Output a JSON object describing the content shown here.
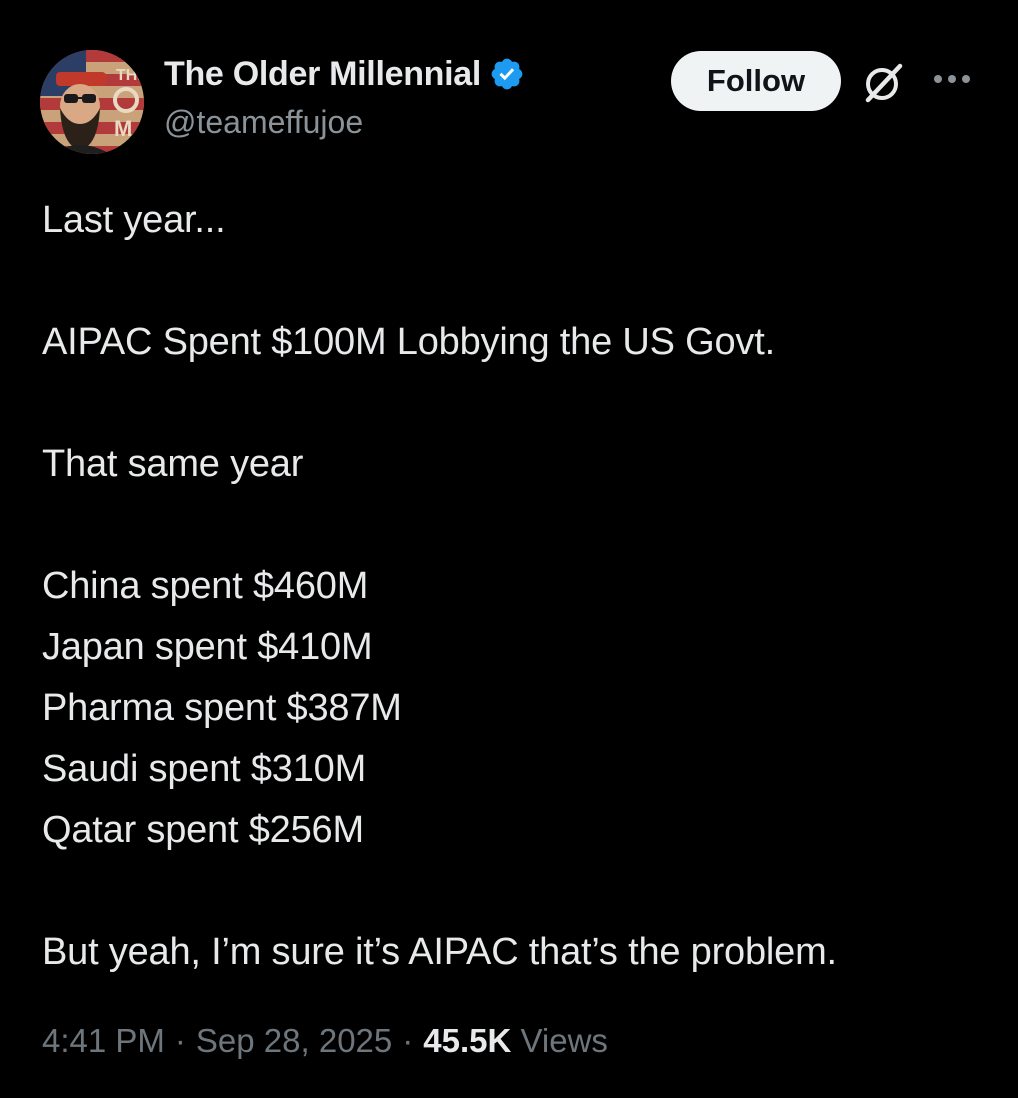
{
  "author": {
    "display_name": "The Older Millennial",
    "handle": "@teameffujoe",
    "verified": true,
    "avatar_icon": "bearded-man-flag-avatar-icon",
    "avatar_text": "THE OM"
  },
  "actions": {
    "follow_label": "Follow",
    "grok_icon": "grok-icon",
    "more_icon": "more-options-icon"
  },
  "tweet": {
    "line1": "Last year...",
    "line2": "AIPAC Spent $100M Lobbying the US Govt.",
    "line3": "That same year",
    "list": [
      "China spent $460M",
      "Japan spent $410M",
      "Pharma spent $387M",
      "Saudi spent $310M",
      "Qatar spent $256M"
    ],
    "closing": "But yeah, I’m sure it’s AIPAC that’s the problem."
  },
  "meta": {
    "time": "4:41 PM",
    "separator": "·",
    "date": "Sep 28, 2025",
    "views_count": "45.5K",
    "views_label": "Views"
  },
  "colors": {
    "background": "#000000",
    "text_primary": "#e7e9ea",
    "text_secondary": "#6e767d",
    "verified_blue": "#1d9bf0",
    "follow_bg": "#eff3f4"
  }
}
